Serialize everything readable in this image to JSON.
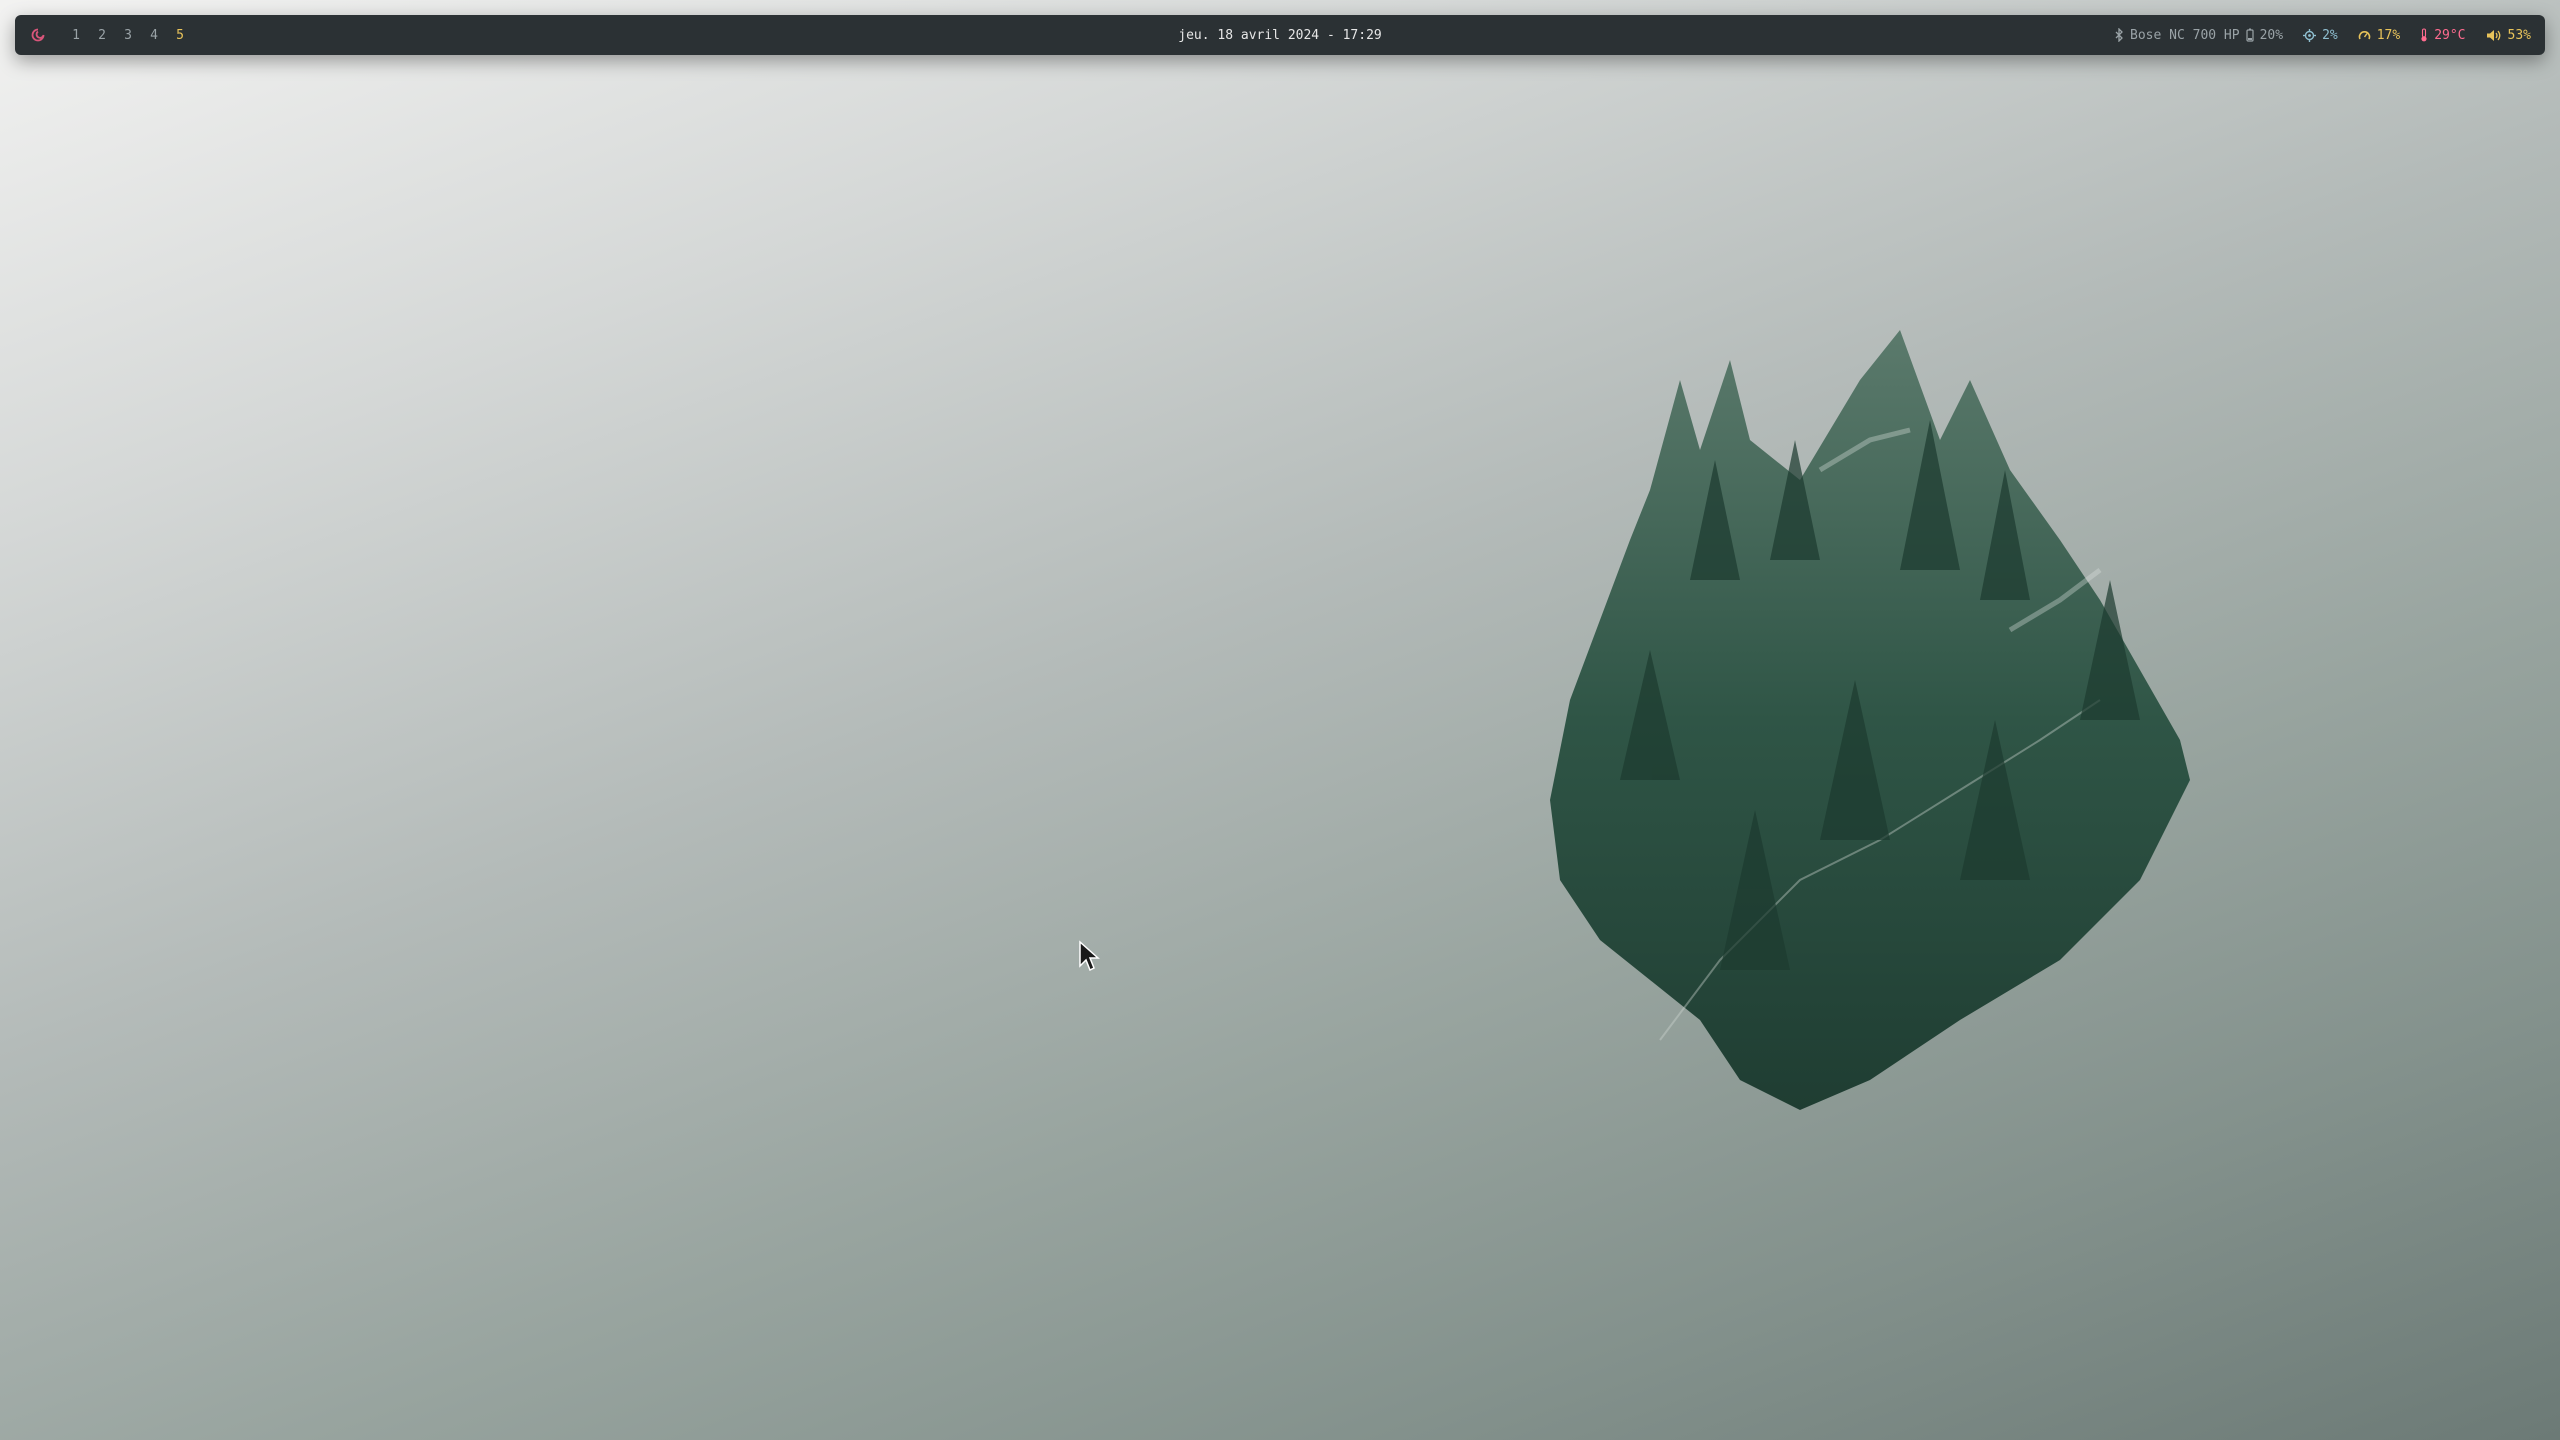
{
  "desktop": {
    "background_top": "#f2f2f1",
    "background_bottom": "#6c7a76"
  },
  "bar": {
    "launcher_icon": "debian-swirl-icon",
    "workspaces": [
      "1",
      "2",
      "3",
      "4",
      "5"
    ],
    "active_workspace": "5",
    "clock": "jeu. 18 avril 2024 - 17:29",
    "bluetooth": {
      "icon": "bluetooth-icon",
      "device": "Bose NC 700 HP",
      "battery_icon": "battery-icon",
      "battery": "20%"
    },
    "cpu": {
      "icon": "cpu-icon",
      "value": "2%"
    },
    "memory": {
      "icon": "gauge-icon",
      "value": "17%"
    },
    "temperature": {
      "icon": "thermometer-icon",
      "value": "29°C"
    },
    "volume": {
      "icon": "speaker-icon",
      "value": "53%"
    }
  },
  "colors": {
    "bar_bg": "#2b3134",
    "accent_yellow": "#e8c35a",
    "accent_pink": "#ff6b8f",
    "accent_cyan": "#8fbfd0"
  }
}
